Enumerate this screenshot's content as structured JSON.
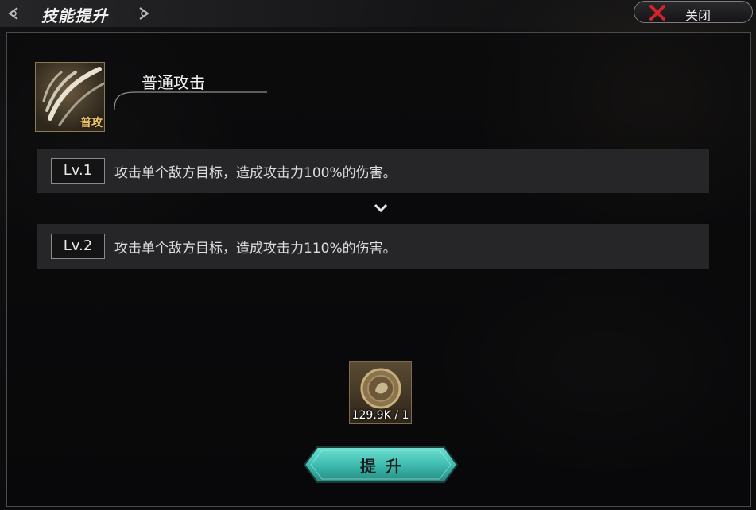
{
  "header": {
    "title": "技能提升",
    "close_label": "关闭"
  },
  "skill": {
    "name": "普通攻击",
    "badge": "普攻"
  },
  "levels": [
    {
      "label": "Lv.1",
      "desc": "攻击单个敌方目标，造成攻击力100%的伤害。"
    },
    {
      "label": "Lv.2",
      "desc": "攻击单个敌方目标，造成攻击力110%的伤害。"
    }
  ],
  "cost": {
    "icon": "coin-icon",
    "count": "129.9K / 1"
  },
  "upgrade_button": {
    "label": "提升"
  },
  "colors": {
    "accent_teal": "#3fbcb0",
    "badge_gold": "#f2c66b",
    "close_red": "#d0232a"
  }
}
